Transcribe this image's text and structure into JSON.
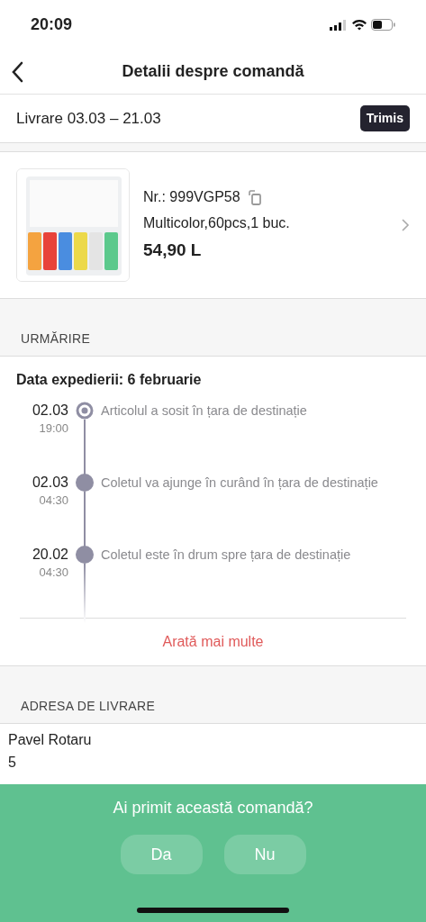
{
  "status_bar": {
    "time": "20:09"
  },
  "header": {
    "title": "Detalii despre comandă"
  },
  "delivery": {
    "text": "Livrare 03.03 – 21.03",
    "status": "Trimis"
  },
  "product": {
    "number": "Nr.: 999VGP58",
    "variant": "Multicolor,60pcs,1 buc.",
    "price": "54,90 L"
  },
  "tracking": {
    "heading": "URMĂRIRE",
    "ship_date": "Data expedierii: 6 februarie",
    "events": [
      {
        "date": "02.03",
        "time": "19:00",
        "text": "Articolul a sosit în țara de destinație",
        "current": true
      },
      {
        "date": "02.03",
        "time": "04:30",
        "text": "Coletul va ajunge în curând în țara de destinație",
        "current": false
      },
      {
        "date": "20.02",
        "time": "04:30",
        "text": "Coletul este în drum spre țara de destinație",
        "current": false
      }
    ],
    "more": "Arată mai multe"
  },
  "address": {
    "heading": "ADRESA DE LIVRARE",
    "lines": [
      "Pavel Rotaru",
      "5"
    ]
  },
  "prompt": {
    "question": "Ai primit această comandă?",
    "buttons": [
      "Da",
      "Nu"
    ]
  }
}
